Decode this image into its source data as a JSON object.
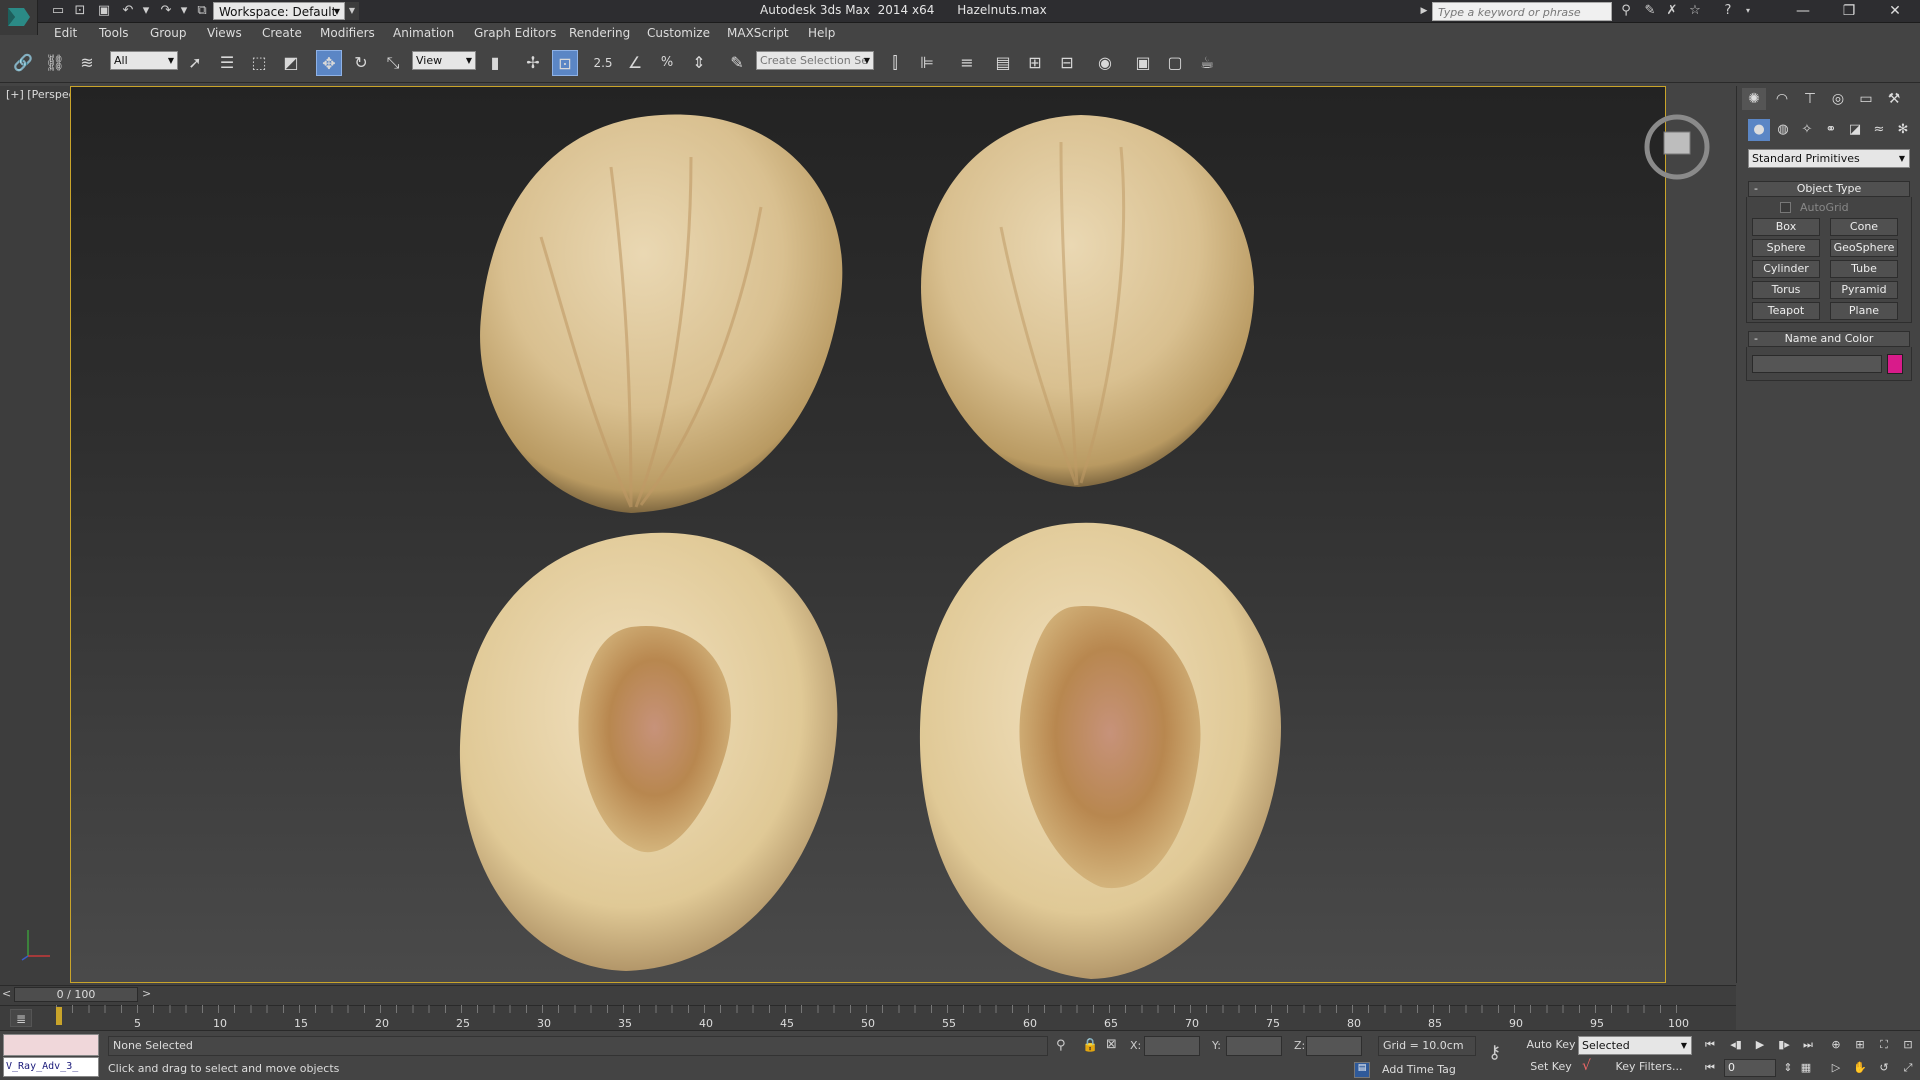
{
  "app": {
    "window_title": "Autodesk 3ds Max  2014 x64      Hazelnuts.max",
    "workspace_label": "Workspace: Default",
    "search_placeholder": "Type a keyword or phrase"
  },
  "menu": [
    "Edit",
    "Tools",
    "Group",
    "Views",
    "Create",
    "Modifiers",
    "Animation",
    "Graph Editors",
    "Rendering",
    "Customize",
    "MAXScript",
    "Help"
  ],
  "toolbar": {
    "selection_filter": "All",
    "ref_coord_system": "View",
    "snap_label": "2.5",
    "named_selection_placeholder": "Create Selection Se"
  },
  "viewport": {
    "label": "[+] [Perspective ] [Shaded ]"
  },
  "command_panel": {
    "category": "Standard Primitives",
    "object_type_title": "Object Type",
    "autogrid_label": "AutoGrid",
    "primitives": [
      "Box",
      "Cone",
      "Sphere",
      "GeoSphere",
      "Cylinder",
      "Tube",
      "Torus",
      "Pyramid",
      "Teapot",
      "Plane"
    ],
    "name_and_color_title": "Name and Color",
    "object_color": "#d81b8a"
  },
  "timeline": {
    "slider_label": "0 / 100",
    "ticks": [
      "5",
      "10",
      "15",
      "20",
      "25",
      "30",
      "35",
      "40",
      "45",
      "50",
      "55",
      "60",
      "65",
      "70",
      "75",
      "80",
      "85",
      "90",
      "95",
      "100"
    ]
  },
  "status": {
    "maxscript_text": "V_Ray_Adv_3_",
    "selection": "None Selected",
    "prompt": "Click and drag to select and move objects",
    "x_label": "X:",
    "y_label": "Y:",
    "z_label": "Z:",
    "grid": "Grid = 10.0cm",
    "add_time_tag": "Add Time Tag",
    "auto_key": "Auto Key",
    "set_key": "Set Key",
    "key_mode": "Selected",
    "key_filters": "Key Filters...",
    "current_frame": "0"
  },
  "colors": {
    "viewport_border": "#c9a42a",
    "active_tool": "#5b86c5"
  }
}
